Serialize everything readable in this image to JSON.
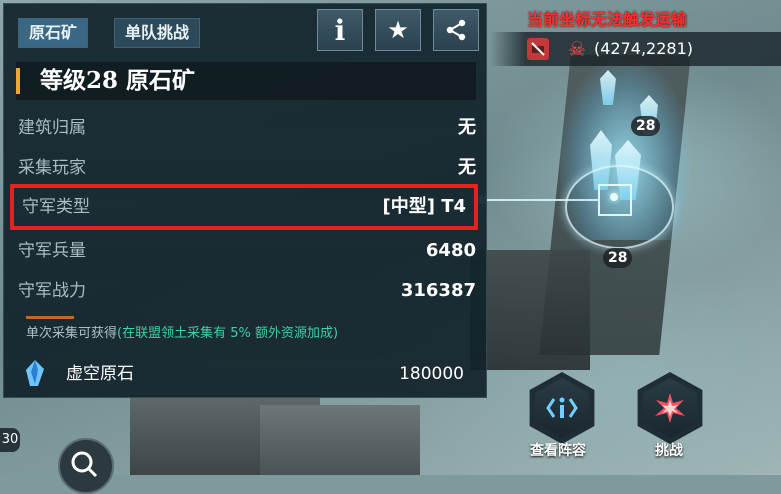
{
  "tabs": [
    {
      "label": "原石矿"
    },
    {
      "label": "单队挑战"
    }
  ],
  "toolbar": {
    "info_label": "i",
    "favorite_label": "★"
  },
  "panel": {
    "title": "等级28 原石矿",
    "rows": [
      {
        "label": "建筑归属",
        "value": "无"
      },
      {
        "label": "采集玩家",
        "value": "无"
      },
      {
        "label": "守军类型",
        "value": "[中型] T4"
      },
      {
        "label": "守军兵量",
        "value": "6480"
      },
      {
        "label": "守军战力",
        "value": "316387"
      }
    ],
    "gather_note_prefix": "单次采集可获得",
    "gather_note_bonus": "(在联盟领土采集有 5% 额外资源加成)",
    "resource": {
      "name": "虚空原石",
      "amount": "180000"
    }
  },
  "map": {
    "warning": "当前坐标无法触发运输",
    "coordinates": "(4274,2281)",
    "level_badge_upper": "28",
    "level_badge_lower": "28"
  },
  "actions": {
    "view_formation": "查看阵容",
    "challenge": "挑战"
  },
  "hud": {
    "left_tag": "30"
  },
  "colors": {
    "highlight_border": "#e52222",
    "warning_text": "#ff2d2d",
    "bonus_text": "#3dd1a3",
    "title_accent": "#f0a733"
  }
}
